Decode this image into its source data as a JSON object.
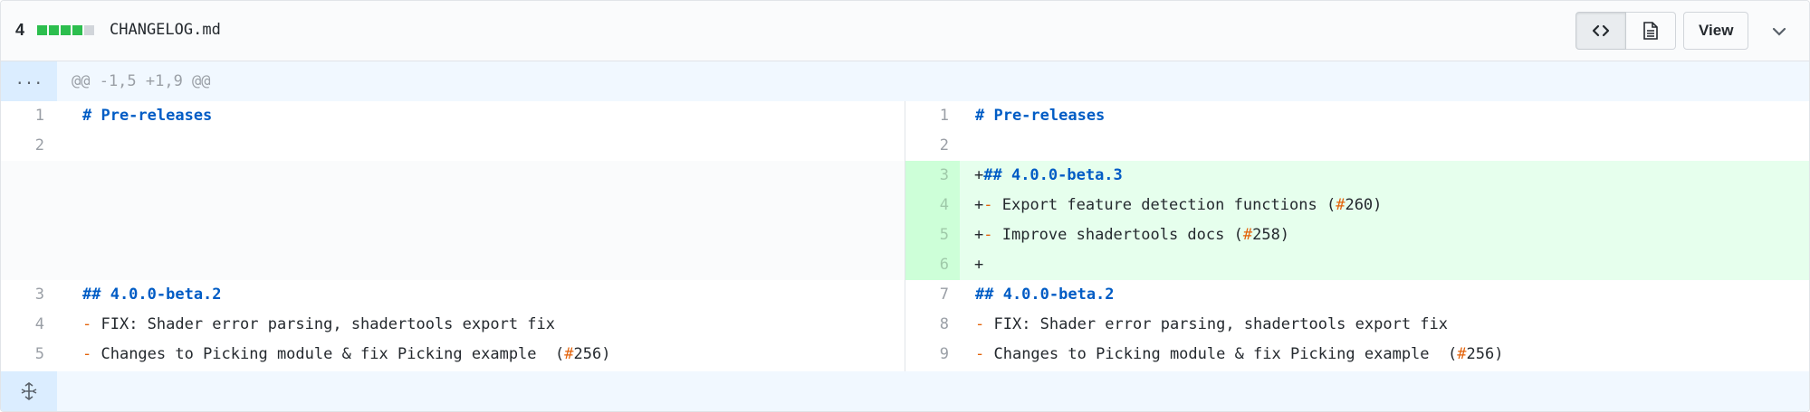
{
  "header": {
    "changes": "4",
    "diffstat": [
      "#2cbe4e",
      "#2cbe4e",
      "#2cbe4e",
      "#2cbe4e",
      "#d1d5da"
    ],
    "filename": "CHANGELOG.md",
    "view_label": "View",
    "icons": [
      "code-icon",
      "file-icon",
      "chevron-down-icon"
    ]
  },
  "hunk": {
    "expand_label": "...",
    "text": "@@ -1,5 +1,9 @@"
  },
  "left": {
    "lines": [
      {
        "num": "1",
        "parts": [
          {
            "cls": "kw",
            "t": "# Pre-releases"
          }
        ]
      },
      {
        "num": "2",
        "parts": []
      },
      {
        "num": "3",
        "parts": [
          {
            "cls": "kw",
            "t": "## 4.0.0-beta.2"
          }
        ]
      },
      {
        "num": "4",
        "parts": [
          {
            "cls": "dash",
            "t": "-"
          },
          {
            "cls": "plain",
            "t": " FIX: Shader error parsing, shadertools export fix"
          }
        ]
      },
      {
        "num": "5",
        "parts": [
          {
            "cls": "dash",
            "t": "-"
          },
          {
            "cls": "plain",
            "t": " Changes to Picking module & fix Picking example  ("
          },
          {
            "cls": "hash",
            "t": "#"
          },
          {
            "cls": "plain",
            "t": "256)"
          }
        ]
      }
    ]
  },
  "right": {
    "lines": [
      {
        "num": "1",
        "parts": [
          {
            "cls": "kw",
            "t": "# Pre-releases"
          }
        ]
      },
      {
        "num": "2",
        "parts": []
      },
      {
        "num": "3",
        "add": true,
        "parts": [
          {
            "cls": "plain",
            "t": "+"
          },
          {
            "cls": "kw",
            "t": "## 4.0.0-beta.3"
          }
        ]
      },
      {
        "num": "4",
        "add": true,
        "parts": [
          {
            "cls": "plain",
            "t": "+"
          },
          {
            "cls": "dash",
            "t": "-"
          },
          {
            "cls": "plain",
            "t": " Export feature detection functions ("
          },
          {
            "cls": "hash",
            "t": "#"
          },
          {
            "cls": "plain",
            "t": "260)"
          }
        ]
      },
      {
        "num": "5",
        "add": true,
        "parts": [
          {
            "cls": "plain",
            "t": "+"
          },
          {
            "cls": "dash",
            "t": "-"
          },
          {
            "cls": "plain",
            "t": " Improve shadertools docs ("
          },
          {
            "cls": "hash",
            "t": "#"
          },
          {
            "cls": "plain",
            "t": "258)"
          }
        ]
      },
      {
        "num": "6",
        "add": true,
        "parts": [
          {
            "cls": "plain",
            "t": "+"
          }
        ]
      },
      {
        "num": "7",
        "parts": [
          {
            "cls": "kw",
            "t": "## 4.0.0-beta.2"
          }
        ]
      },
      {
        "num": "8",
        "parts": [
          {
            "cls": "dash",
            "t": "-"
          },
          {
            "cls": "plain",
            "t": " FIX: Shader error parsing, shadertools export fix"
          }
        ]
      },
      {
        "num": "9",
        "parts": [
          {
            "cls": "dash",
            "t": "-"
          },
          {
            "cls": "plain",
            "t": " Changes to Picking module & fix Picking example  ("
          },
          {
            "cls": "hash",
            "t": "#"
          },
          {
            "cls": "plain",
            "t": "256)"
          }
        ]
      }
    ]
  },
  "footer": {
    "icon": "unfold-icon"
  }
}
